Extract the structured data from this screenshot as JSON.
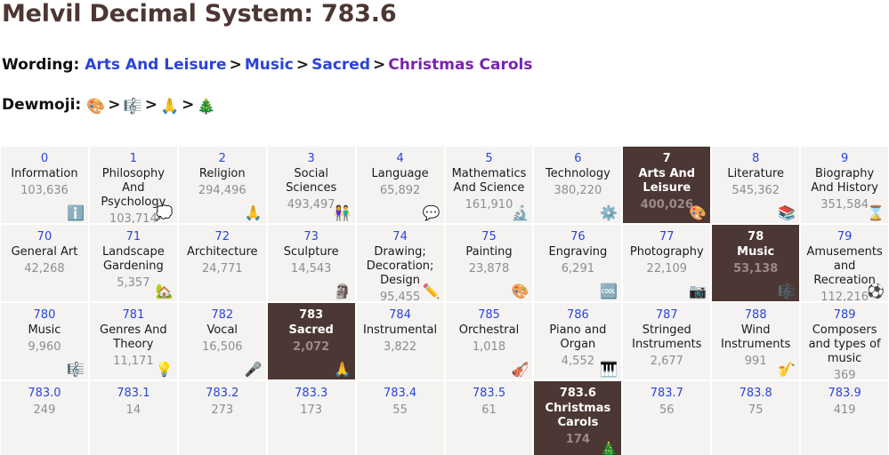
{
  "header": {
    "title": "Melvil Decimal System: 783.6",
    "wording_label": "Wording:",
    "dewmoji_label": "Dewmoji:",
    "separator": ">",
    "wording_crumbs": [
      {
        "text": "Arts And Leisure",
        "state": "link"
      },
      {
        "text": "Music",
        "state": "link"
      },
      {
        "text": "Sacred",
        "state": "link"
      },
      {
        "text": "Christmas Carols",
        "state": "visited"
      }
    ],
    "dewmoji_crumbs": [
      {
        "emoji": "🎨",
        "name": "artist-palette-emoji"
      },
      {
        "emoji": "🎼",
        "name": "musical-score-emoji"
      },
      {
        "emoji": "🙏",
        "name": "folded-hands-emoji"
      },
      {
        "emoji": "🎄",
        "name": "christmas-tree-emoji"
      }
    ]
  },
  "colors": {
    "title": "#4d3733",
    "highlight_bg": "#4b3733",
    "cell_bg": "#f4f3f1",
    "link": "#2b44d8",
    "visited_link": "#7a22b0",
    "count": "#8e8e8e"
  },
  "grid": {
    "rows": [
      {
        "name": "row-hundreds",
        "cells": [
          {
            "num": "0",
            "label": "Information",
            "count": "103,636",
            "emoji": "ℹ️",
            "emoji_name": "information-emoji",
            "current": false
          },
          {
            "num": "1",
            "label": "Philosophy And Psychology",
            "count": "103,714",
            "emoji": "💭",
            "emoji_name": "thought-balloon-emoji",
            "current": false
          },
          {
            "num": "2",
            "label": "Religion",
            "count": "294,496",
            "emoji": "🙏",
            "emoji_name": "folded-hands-emoji",
            "current": false
          },
          {
            "num": "3",
            "label": "Social Sciences",
            "count": "493,497",
            "emoji": "👫",
            "emoji_name": "couple-emoji",
            "current": false
          },
          {
            "num": "4",
            "label": "Language",
            "count": "65,892",
            "emoji": "💬",
            "emoji_name": "speech-balloon-emoji",
            "current": false
          },
          {
            "num": "5",
            "label": "Mathematics And Science",
            "count": "161,910",
            "emoji": "🔬",
            "emoji_name": "microscope-emoji",
            "current": false
          },
          {
            "num": "6",
            "label": "Technology",
            "count": "380,220",
            "emoji": "⚙️",
            "emoji_name": "gear-emoji",
            "current": false
          },
          {
            "num": "7",
            "label": "Arts And Leisure",
            "count": "400,026",
            "emoji": "🎨",
            "emoji_name": "artist-palette-emoji",
            "current": true
          },
          {
            "num": "8",
            "label": "Literature",
            "count": "545,362",
            "emoji": "📚",
            "emoji_name": "books-emoji",
            "current": false
          },
          {
            "num": "9",
            "label": "Biography And History",
            "count": "351,584",
            "emoji": "⌛",
            "emoji_name": "hourglass-emoji",
            "current": false
          }
        ]
      },
      {
        "name": "row-tens",
        "cells": [
          {
            "num": "70",
            "label": "General Art",
            "count": "42,268",
            "emoji": "",
            "emoji_name": "",
            "current": false
          },
          {
            "num": "71",
            "label": "Landscape Gardening",
            "count": "5,357",
            "emoji": "🏡",
            "emoji_name": "house-with-garden-emoji",
            "current": false
          },
          {
            "num": "72",
            "label": "Architecture",
            "count": "24,771",
            "emoji": "",
            "emoji_name": "",
            "current": false
          },
          {
            "num": "73",
            "label": "Sculpture",
            "count": "14,543",
            "emoji": "🗿",
            "emoji_name": "moai-emoji",
            "current": false
          },
          {
            "num": "74",
            "label": "Drawing; Decoration; Design",
            "count": "95,455",
            "emoji": "✏️",
            "emoji_name": "pencil-emoji",
            "current": false
          },
          {
            "num": "75",
            "label": "Painting",
            "count": "23,878",
            "emoji": "🎨",
            "emoji_name": "artist-palette-emoji",
            "current": false
          },
          {
            "num": "76",
            "label": "Engraving",
            "count": "6,291",
            "emoji": "🆒",
            "emoji_name": "cool-button-emoji",
            "current": false
          },
          {
            "num": "77",
            "label": "Photography",
            "count": "22,109",
            "emoji": "📷",
            "emoji_name": "camera-emoji",
            "current": false
          },
          {
            "num": "78",
            "label": "Music",
            "count": "53,138",
            "emoji": "🎼",
            "emoji_name": "musical-score-emoji",
            "current": true
          },
          {
            "num": "79",
            "label": "Amusements and Recreation",
            "count": "112,216",
            "emoji": "⚽",
            "emoji_name": "soccer-ball-emoji",
            "current": false
          }
        ]
      },
      {
        "name": "row-units",
        "cells": [
          {
            "num": "780",
            "label": "Music",
            "count": "9,960",
            "emoji": "🎼",
            "emoji_name": "musical-score-emoji",
            "current": false
          },
          {
            "num": "781",
            "label": "Genres And Theory",
            "count": "11,171",
            "emoji": "💡",
            "emoji_name": "light-bulb-emoji",
            "current": false
          },
          {
            "num": "782",
            "label": "Vocal",
            "count": "16,506",
            "emoji": "🎤",
            "emoji_name": "microphone-emoji",
            "current": false
          },
          {
            "num": "783",
            "label": "Sacred",
            "count": "2,072",
            "emoji": "🙏",
            "emoji_name": "folded-hands-emoji",
            "current": true
          },
          {
            "num": "784",
            "label": "Instrumental",
            "count": "3,822",
            "emoji": "",
            "emoji_name": "",
            "current": false
          },
          {
            "num": "785",
            "label": "Orchestral",
            "count": "1,018",
            "emoji": "🎻",
            "emoji_name": "violin-emoji",
            "current": false
          },
          {
            "num": "786",
            "label": "Piano and Organ",
            "count": "4,552",
            "emoji": "🎹",
            "emoji_name": "musical-keyboard-emoji",
            "current": false
          },
          {
            "num": "787",
            "label": "Stringed Instruments",
            "count": "2,677",
            "emoji": "",
            "emoji_name": "",
            "current": false
          },
          {
            "num": "788",
            "label": "Wind Instruments",
            "count": "991",
            "emoji": "🎷",
            "emoji_name": "saxophone-emoji",
            "current": false
          },
          {
            "num": "789",
            "label": "Composers and types of music",
            "count": "369",
            "emoji": "",
            "emoji_name": "",
            "current": false
          }
        ]
      },
      {
        "name": "row-decimals",
        "cells": [
          {
            "num": "783.0",
            "label": "",
            "count": "249",
            "emoji": "",
            "emoji_name": "",
            "current": false
          },
          {
            "num": "783.1",
            "label": "",
            "count": "14",
            "emoji": "",
            "emoji_name": "",
            "current": false
          },
          {
            "num": "783.2",
            "label": "",
            "count": "273",
            "emoji": "",
            "emoji_name": "",
            "current": false
          },
          {
            "num": "783.3",
            "label": "",
            "count": "173",
            "emoji": "",
            "emoji_name": "",
            "current": false
          },
          {
            "num": "783.4",
            "label": "",
            "count": "55",
            "emoji": "",
            "emoji_name": "",
            "current": false
          },
          {
            "num": "783.5",
            "label": "",
            "count": "61",
            "emoji": "",
            "emoji_name": "",
            "current": false
          },
          {
            "num": "783.6",
            "label": "Christmas Carols",
            "count": "174",
            "emoji": "🎄",
            "emoji_name": "christmas-tree-emoji",
            "current": true
          },
          {
            "num": "783.7",
            "label": "",
            "count": "56",
            "emoji": "",
            "emoji_name": "",
            "current": false
          },
          {
            "num": "783.8",
            "label": "",
            "count": "75",
            "emoji": "",
            "emoji_name": "",
            "current": false
          },
          {
            "num": "783.9",
            "label": "",
            "count": "419",
            "emoji": "",
            "emoji_name": "",
            "current": false
          }
        ]
      }
    ]
  }
}
